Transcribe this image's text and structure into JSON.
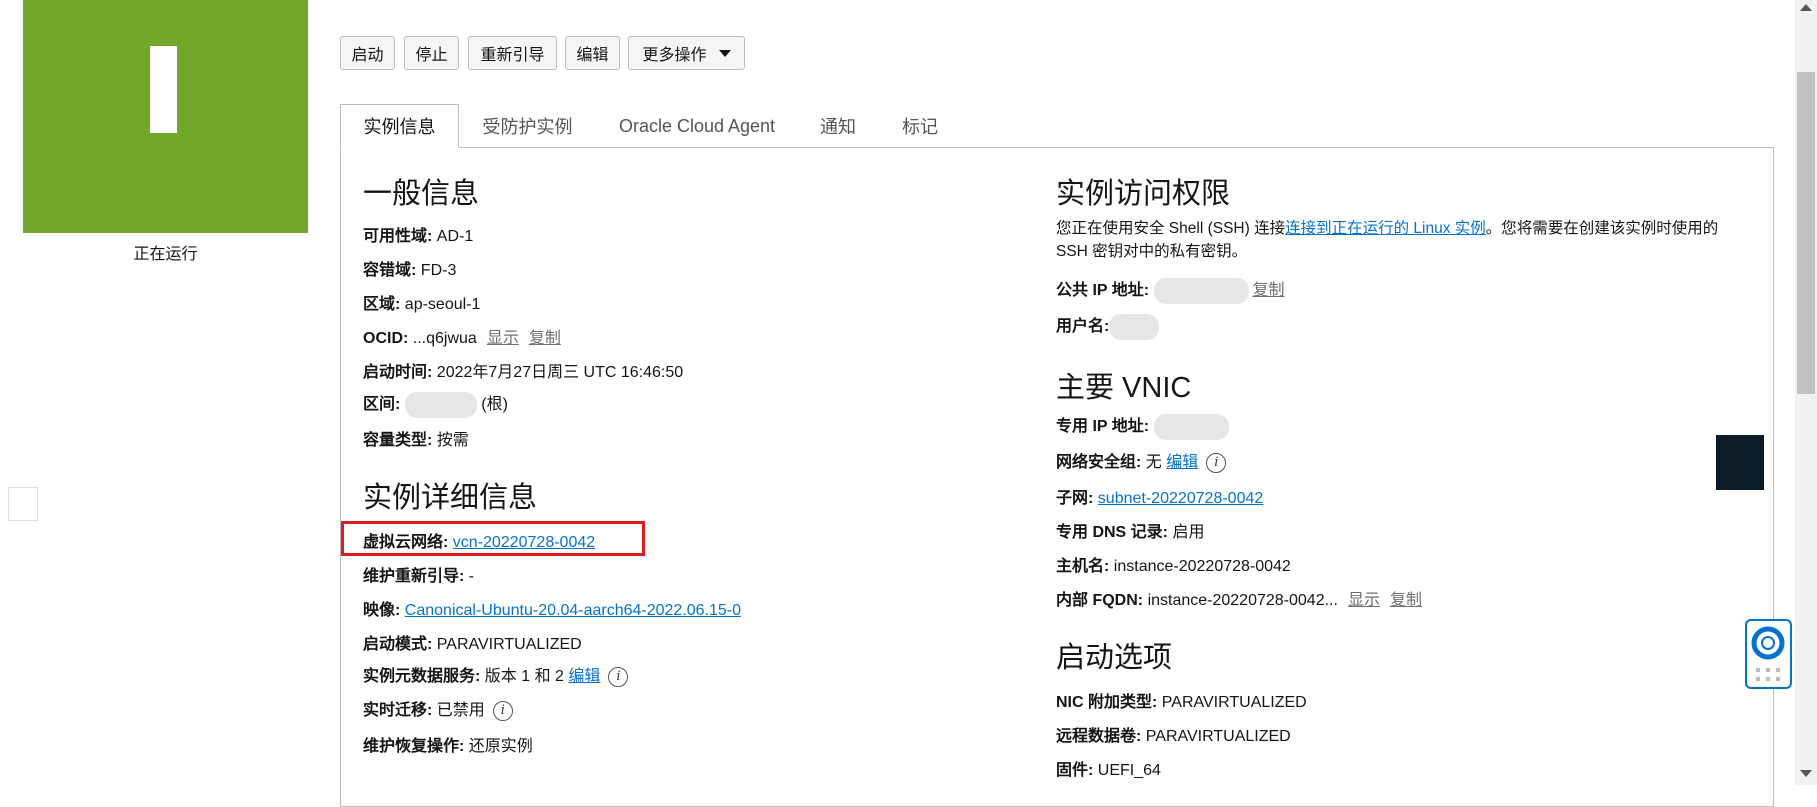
{
  "status": {
    "label": "正在运行",
    "color": "#72a72a"
  },
  "toolbar": {
    "start": "启动",
    "stop": "停止",
    "reboot": "重新引导",
    "edit": "编辑",
    "more": "更多操作"
  },
  "tabs": [
    "实例信息",
    "受防护实例",
    "Oracle Cloud Agent",
    "通知",
    "标记"
  ],
  "general": {
    "title": "一般信息",
    "ad_label": "可用性域:",
    "ad_value": "AD-1",
    "fd_label": "容错域:",
    "fd_value": "FD-3",
    "region_label": "区域:",
    "region_value": "ap-seoul-1",
    "ocid_label": "OCID:",
    "ocid_value": "...q6jwua",
    "show": "显示",
    "copy": "复制",
    "launch_label": "启动时间:",
    "launch_value": "2022年7月27日周三 UTC 16:46:50",
    "compartment_label": "区间:",
    "compartment_suffix": "(根)",
    "capacity_label": "容量类型:",
    "capacity_value": "按需"
  },
  "details": {
    "title": "实例详细信息",
    "vcn_label": "虚拟云网络:",
    "vcn_value": "vcn-20220728-0042",
    "maint_reboot_label": "维护重新引导:",
    "maint_reboot_value": "-",
    "image_label": "映像:",
    "image_value": "Canonical-Ubuntu-20.04-aarch64-2022.06.15-0",
    "launch_mode_label": "启动模式:",
    "launch_mode_value": "PARAVIRTUALIZED",
    "metadata_label": "实例元数据服务:",
    "metadata_value": "版本 1 和 2",
    "edit": "编辑",
    "migration_label": "实时迁移:",
    "migration_value": "已禁用",
    "recovery_label": "维护恢复操作:",
    "recovery_value": "还原实例"
  },
  "access": {
    "title": "实例访问权限",
    "desc_prefix": "您正在使用安全 Shell (SSH) 连接",
    "desc_link": "连接到正在运行的 Linux 实例",
    "desc_suffix": "。您将需要在创建该实例时使用的",
    "desc_line2": "SSH 密钥对中的私有密钥。",
    "public_ip_label": "公共 IP 地址:",
    "copy": "复制",
    "username_label": "用户名:"
  },
  "vnic": {
    "title": "主要 VNIC",
    "private_ip_label": "专用 IP 地址:",
    "nsg_label": "网络安全组:",
    "nsg_value": "无",
    "edit": "编辑",
    "subnet_label": "子网:",
    "subnet_value": "subnet-20220728-0042",
    "dns_label": "专用 DNS 记录:",
    "dns_value": "启用",
    "hostname_label": "主机名:",
    "hostname_value": "instance-20220728-0042",
    "fqdn_label": "内部 FQDN:",
    "fqdn_value": "instance-20220728-0042...",
    "show": "显示",
    "copy": "复制"
  },
  "launch_options": {
    "title": "启动选项",
    "nic_label": "NIC 附加类型:",
    "nic_value": "PARAVIRTUALIZED",
    "remote_label": "远程数据卷:",
    "remote_value": "PARAVIRTUALIZED",
    "firmware_label": "固件:",
    "firmware_value": "UEFI_64"
  }
}
